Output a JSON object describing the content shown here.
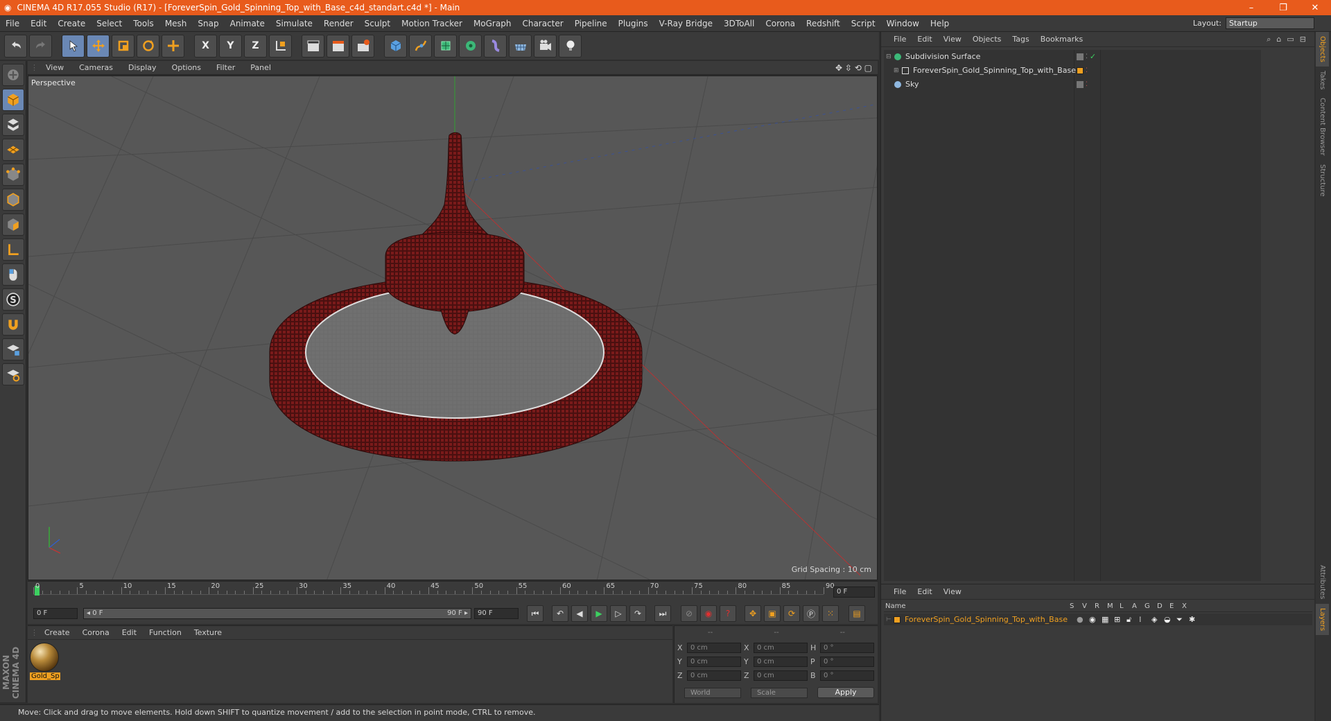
{
  "window": {
    "title": "CINEMA 4D R17.055 Studio (R17) - [ForeverSpin_Gold_Spinning_Top_with_Base_c4d_standart.c4d *] - Main",
    "minimize": "–",
    "restore": "❐",
    "close": "✕"
  },
  "menubar": {
    "items": [
      "File",
      "Edit",
      "Create",
      "Select",
      "Tools",
      "Mesh",
      "Snap",
      "Animate",
      "Simulate",
      "Render",
      "Sculpt",
      "Motion Tracker",
      "MoGraph",
      "Character",
      "Pipeline",
      "Plugins",
      "V-Ray Bridge",
      "3DToAll",
      "Corona",
      "Redshift",
      "Script",
      "Window",
      "Help"
    ],
    "layout_label": "Layout:",
    "layout_value": "Startup"
  },
  "toolbar": {
    "x_label": "X",
    "y_label": "Y",
    "z_label": "Z"
  },
  "viewport": {
    "menu": [
      "View",
      "Cameras",
      "Display",
      "Options",
      "Filter",
      "Panel"
    ],
    "label": "Perspective",
    "grid_spacing": "Grid Spacing : 10 cm",
    "nav_icons": "✥ ⇳ ⟲ ▢"
  },
  "timeline": {
    "ticks": [
      "0",
      "5",
      "10",
      "15",
      "20",
      "25",
      "30",
      "35",
      "40",
      "45",
      "50",
      "55",
      "60",
      "65",
      "70",
      "75",
      "80",
      "85",
      "90"
    ],
    "current_frame": "0 F",
    "start_field": "0 F",
    "range_start": "◂ 0 F",
    "range_end": "90 F ▸",
    "end_field": "90 F"
  },
  "materials": {
    "menu": [
      "Create",
      "Corona",
      "Edit",
      "Function",
      "Texture"
    ],
    "items": [
      {
        "name": "Gold_Sp"
      }
    ]
  },
  "coords": {
    "header": [
      "--",
      "--",
      "--"
    ],
    "rows": [
      {
        "l1": "X",
        "v1": "0 cm",
        "l2": "X",
        "v2": "0 cm",
        "l3": "H",
        "v3": "0 °"
      },
      {
        "l1": "Y",
        "v1": "0 cm",
        "l2": "Y",
        "v2": "0 cm",
        "l3": "P",
        "v3": "0 °"
      },
      {
        "l1": "Z",
        "v1": "0 cm",
        "l2": "Z",
        "v2": "0 cm",
        "l3": "B",
        "v3": "0 °"
      }
    ],
    "world": "World",
    "scale": "Scale",
    "apply": "Apply"
  },
  "statusbar": {
    "text": "Move: Click and drag to move elements. Hold down SHIFT to quantize movement / add to the selection in point mode, CTRL to remove."
  },
  "objects": {
    "menu": [
      "File",
      "Edit",
      "View",
      "Objects",
      "Tags",
      "Bookmarks"
    ],
    "items": [
      {
        "name": "Subdivision Surface"
      },
      {
        "name": "ForeverSpin_Gold_Spinning_Top_with_Base"
      },
      {
        "name": "Sky"
      }
    ]
  },
  "sidetabs": [
    "Objects",
    "Takes",
    "Content Browser",
    "Structure",
    "Attributes",
    "Layers"
  ],
  "layers": {
    "menu": [
      "File",
      "Edit",
      "View"
    ],
    "columns": [
      "Name",
      "S",
      "V",
      "R",
      "M",
      "L",
      "A",
      "G",
      "D",
      "E",
      "X"
    ],
    "items": [
      {
        "name": "ForeverSpin_Gold_Spinning_Top_with_Base"
      }
    ]
  },
  "colors": {
    "title_bar": "#e85b1c",
    "accent_orange": "#f0a020",
    "active_tool": "#6a88b5",
    "viewport_bg": "#575757",
    "model_red": "#5a1414",
    "axis_x": "#c03030",
    "axis_y": "#30a030",
    "axis_z": "#3050b0"
  }
}
